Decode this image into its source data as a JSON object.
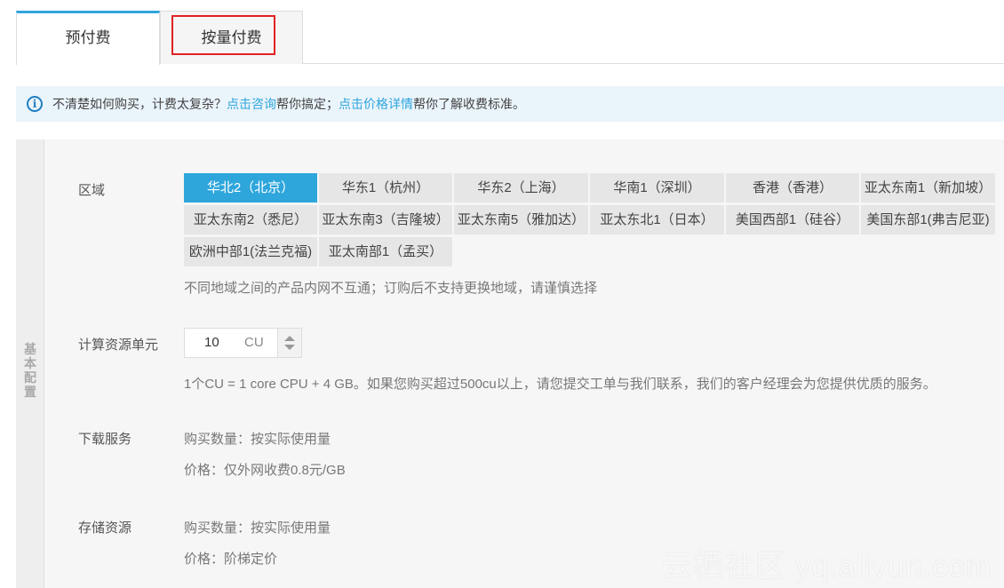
{
  "tabs": [
    {
      "label": "预付费",
      "active": true
    },
    {
      "label": "按量付费",
      "active": false
    }
  ],
  "notice": {
    "prefix": "不清楚如何购买，计费太复杂？",
    "link1": "点击咨询",
    "middle": "帮你搞定；",
    "link2": "点击价格详情",
    "suffix": "帮你了解收费标准。"
  },
  "side_label": "基本配置",
  "region": {
    "label": "区域",
    "options": [
      "华北2（北京）",
      "华东1（杭州）",
      "华东2（上海）",
      "华南1（深圳）",
      "香港（香港）",
      "亚太东南1（新加坡）",
      "亚太东南2（悉尼）",
      "亚太东南3（吉隆坡）",
      "亚太东南5（雅加达）",
      "亚太东北1（日本）",
      "美国西部1（硅谷）",
      "美国东部1(弗吉尼亚)",
      "欧洲中部1(法兰克福)",
      "亚太南部1（孟买）"
    ],
    "selected": "华北2（北京）",
    "hint": "不同地域之间的产品内网不互通；订购后不支持更换地域，请谨慎选择"
  },
  "compute": {
    "label": "计算资源单元",
    "value": "10",
    "unit": "CU",
    "hint": "1个CU = 1 core CPU + 4 GB。如果您购买超过500cu以上，请您提交工单与我们联系，我们的客户经理会为您提供优质的服务。"
  },
  "download": {
    "label": "下载服务",
    "quantity": "购买数量：按实际使用量",
    "price": "价格：仅外网收费0.8元/GB"
  },
  "storage": {
    "label": "存储资源",
    "quantity": "购买数量：按实际使用量",
    "price": "价格：阶梯定价"
  },
  "watermark": "云栖社区 yq.aliyun.com",
  "colors": {
    "accent": "#2ea6dc",
    "highlight_box": "#e02222",
    "notice_bg": "#eaf4fb"
  }
}
